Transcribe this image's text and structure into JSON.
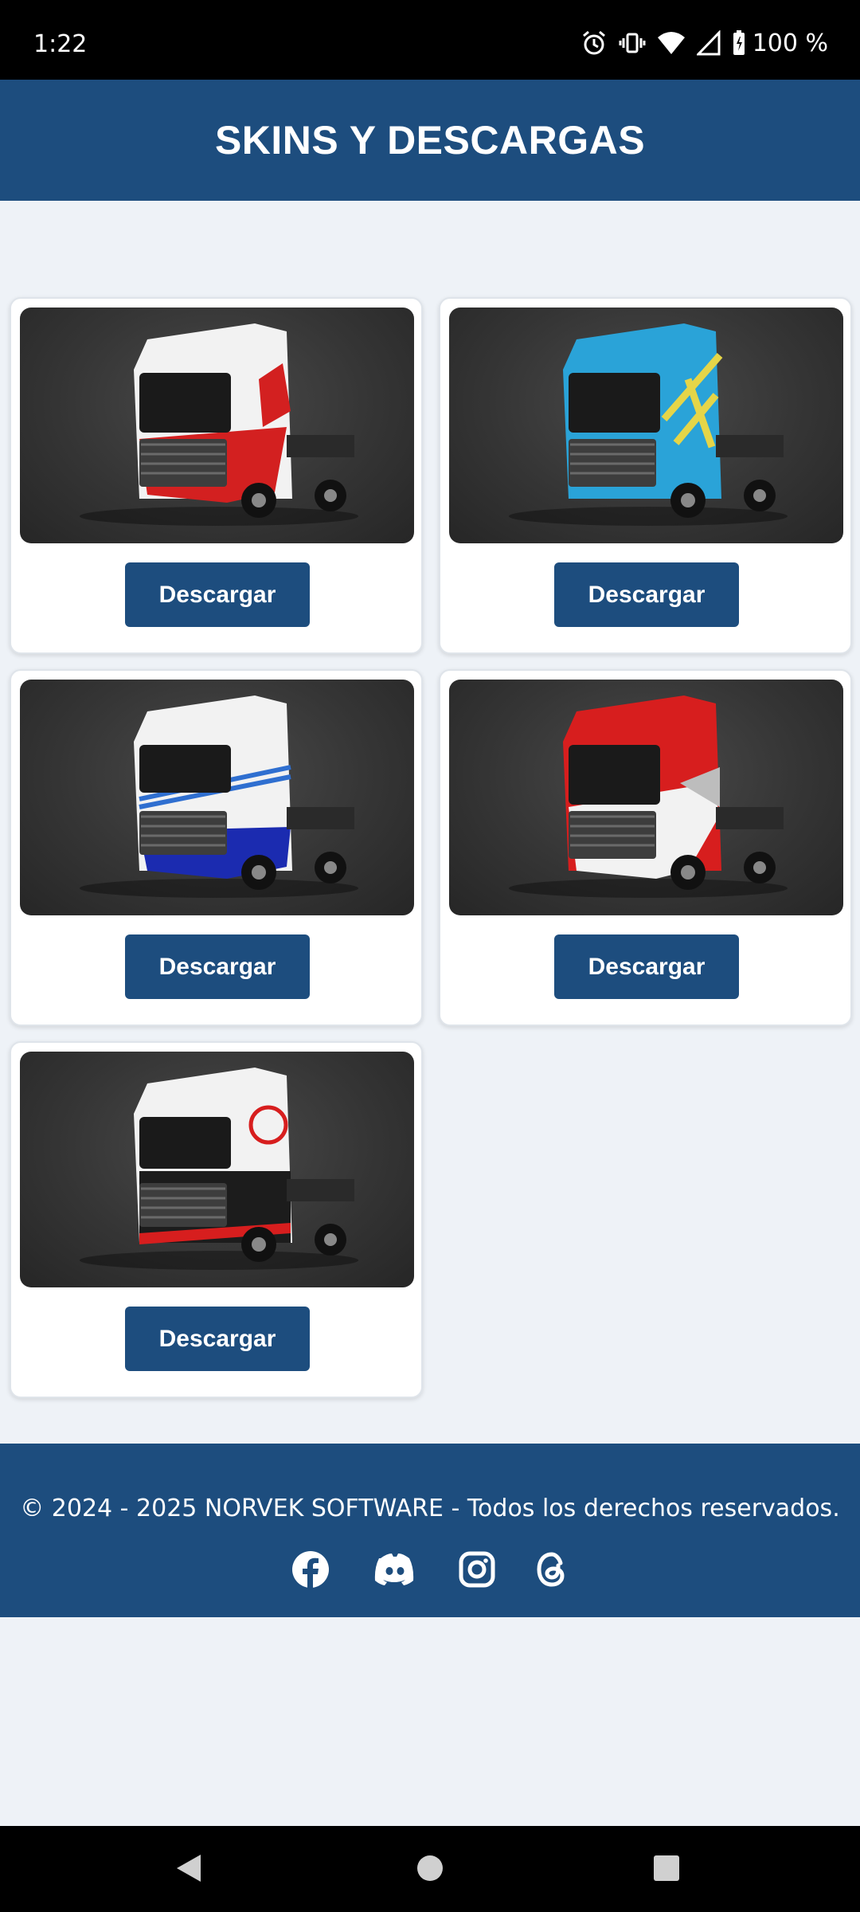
{
  "status_bar": {
    "time": "1:22",
    "battery": "100 %",
    "icons": [
      "alarm-icon",
      "vibrate-icon",
      "wifi-icon",
      "signal-icon",
      "battery-icon"
    ]
  },
  "header": {
    "title": "SKINS Y DESCARGAS",
    "background": "#1d4d7e"
  },
  "skins": [
    {
      "button_label": "Descargar",
      "livery": "white-red",
      "colors": [
        "#f2f2f2",
        "#d32020"
      ]
    },
    {
      "button_label": "Descargar",
      "livery": "blue-yellow",
      "colors": [
        "#2aa3d8",
        "#e5d548"
      ]
    },
    {
      "button_label": "Descargar",
      "livery": "white-blue-volvo",
      "colors": [
        "#f2f2f2",
        "#1b2bb0"
      ]
    },
    {
      "button_label": "Descargar",
      "livery": "red-white",
      "colors": [
        "#d71e1e",
        "#f2f2f2"
      ]
    },
    {
      "button_label": "Descargar",
      "livery": "white-black-red-haas",
      "colors": [
        "#f2f2f2",
        "#d71e1e"
      ]
    }
  ],
  "footer": {
    "copyright": "© 2024 - 2025 NORVEK SOFTWARE - Todos los derechos reservados.",
    "social": [
      "facebook-icon",
      "discord-icon",
      "instagram-icon",
      "threads-icon"
    ]
  },
  "nav_bar": {
    "buttons": [
      "back-icon",
      "home-icon",
      "recents-icon"
    ]
  }
}
